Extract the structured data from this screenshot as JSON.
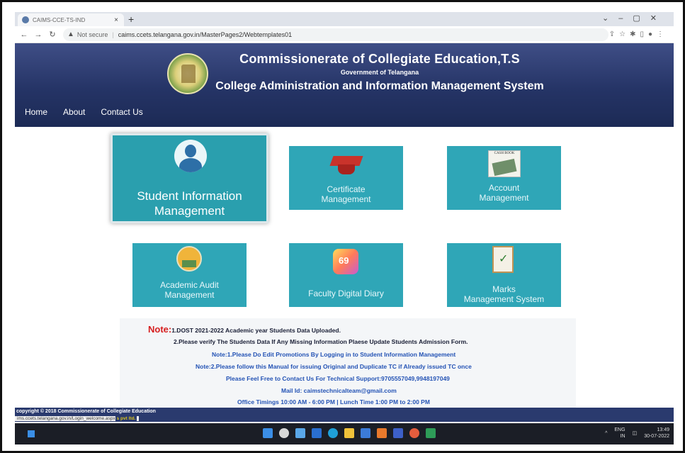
{
  "browser": {
    "tab_title": "CAIMS-CCE-TS-IND",
    "tab_close": "×",
    "new_tab": "+",
    "not_secure": "Not secure",
    "url": "caims.ccets.telangana.gov.in/MasterPages2/Webtemplates01"
  },
  "header": {
    "title": "Commissionerate of Collegiate Education,T.S",
    "subtitle": "Government of Telangana",
    "system_name": "College Administration and Information Management System"
  },
  "nav": [
    "Home",
    "About",
    "Contact Us"
  ],
  "tiles": {
    "student": "Student Information\nManagement",
    "certificate": "Certificate\nManagement",
    "account": "Account\nManagement",
    "audit": "Academic Audit\nManagement",
    "diary": "Faculty Digital Diary",
    "marks": "Marks\nManagement System",
    "cash_book_label": "CASH BOOK"
  },
  "notes": {
    "note_label": "Note:",
    "line1": "1.DOST 2021-2022 Academic year Students Data Uploaded.",
    "line2": "2.Please verify The Students Data If Any Missing Information Plaese Update Students Admission Form.",
    "line3": "Note:1.Please Do Edit Promotions By Logging in to Student Information Management",
    "line4": "Note:2.Please follow this Manual for issuing Original and Duplicate TC if Already issued TC once",
    "line5": "Please Feel Free to Contact Us For Technical Support:9705557049,9948197049",
    "line6": "Mail Id: caimstechnicalteam@gmail.com",
    "line7": "Office Timings 10:00 AM - 6:00 PM | Lunch Time 1:00 PM to 2:00 PM"
  },
  "footer": {
    "copyright": "copyright © 2018 Commissionerate of Collegiate Education",
    "status_url": "ims.ccets.telangana.gov.in/Login_welcome.aspx",
    "status_suffix": "s pvt ltd."
  },
  "taskbar": {
    "lang": "ENG",
    "lang2": "IN",
    "time": "13:49",
    "date": "30-07-2022"
  },
  "colors": {
    "header_bg": "#253466",
    "tile_bg": "#2fa6b7",
    "note_red": "#d61e1e",
    "note_blue": "#2453b5"
  }
}
